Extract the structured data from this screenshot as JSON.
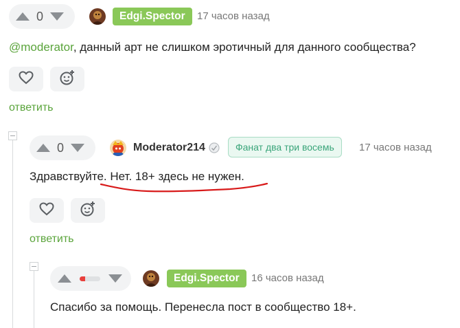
{
  "comments": [
    {
      "votes": "0",
      "author": "Edgi.Spector",
      "time": "17 часов назад",
      "mention": "@moderator",
      "text": ", данный арт не слишком эротичный для данного сообщества?",
      "reply_label": "ответить"
    },
    {
      "votes": "0",
      "author": "Moderator214",
      "community": "Фанат два три восемь",
      "time": "17 часов назад",
      "text": "Здравствуйте. Нет. 18+ здесь не нужен.",
      "reply_label": "ответить"
    },
    {
      "rating_fraction": 0.28,
      "author": "Edgi.Spector",
      "time": "16 часов назад",
      "text": "Спасибо за помощь. Перенесла пост в сообщество 18+."
    }
  ],
  "colors": {
    "accent": "#5aa43b",
    "badge": "#8ac858",
    "underline": "#d81a1a",
    "community": "#3aa57a"
  },
  "icons": [
    "arrow-up-icon",
    "arrow-down-icon",
    "heart-icon",
    "emoji-add-icon",
    "collapse-icon",
    "verified-icon"
  ]
}
